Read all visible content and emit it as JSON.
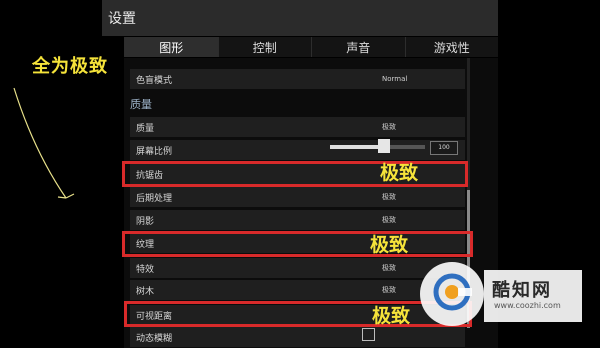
{
  "header": {
    "title": "设置"
  },
  "tabs": [
    {
      "label": "图形",
      "active": true
    },
    {
      "label": "控制",
      "active": false
    },
    {
      "label": "声音",
      "active": false
    },
    {
      "label": "游戏性",
      "active": false
    }
  ],
  "rows": {
    "color_blind": {
      "label": "色盲模式",
      "value": "Normal"
    },
    "quality": {
      "label": "质量",
      "value": "极致"
    },
    "screen_scale": {
      "label": "屏幕比例",
      "value": "100"
    },
    "antialias": {
      "label": "抗锯齿",
      "value": "极致"
    },
    "post_process": {
      "label": "后期处理",
      "value": "极致"
    },
    "shadow": {
      "label": "阴影",
      "value": "极致"
    },
    "texture": {
      "label": "纹理",
      "value": "极致"
    },
    "effects": {
      "label": "特效",
      "value": "极致"
    },
    "foliage": {
      "label": "树木",
      "value": "极致"
    },
    "view_distance": {
      "label": "可视距离",
      "value": "极致"
    },
    "motion_blur": {
      "label": "动态模糊",
      "value": ""
    }
  },
  "section": {
    "quality_header": "质量"
  },
  "annotations": {
    "left": "全为极致",
    "antialias": "极致",
    "texture": "极致",
    "view_distance": "极致"
  },
  "watermark": {
    "name": "酷知网",
    "url": "www.coozhi.com"
  },
  "colors": {
    "highlight": "#d82a2a",
    "annotation": "#f5e33a"
  }
}
